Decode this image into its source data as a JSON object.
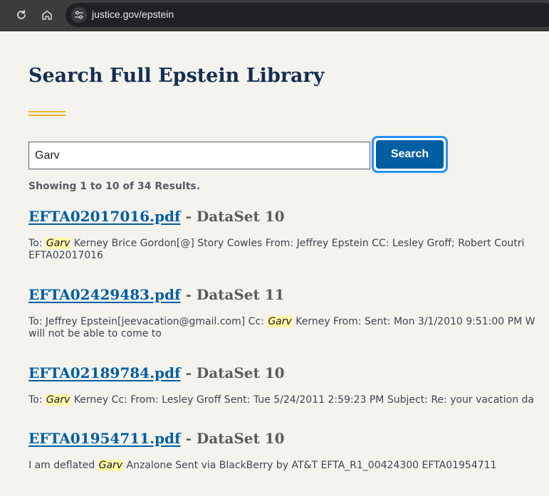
{
  "browser": {
    "url": "justice.gov/epstein"
  },
  "page": {
    "title": "Search Full Epstein Library"
  },
  "search": {
    "value": "Garv",
    "button_label": "Search",
    "results_count": "Showing 1 to 10 of 34 Results."
  },
  "results": [
    {
      "file": "EFTA02017016.pdf",
      "dataset": "- DataSet 10",
      "snippet_lines": [
        {
          "before": "To: ",
          "highlight": "Garv",
          "after": " Kerney Brice Gordon[@] Story Cowles From: Jeffrey Epstein CC: Lesley Groff; Robert Coutri"
        },
        {
          "before": "EFTA02017016",
          "highlight": "",
          "after": ""
        }
      ]
    },
    {
      "file": "EFTA02429483.pdf",
      "dataset": "- DataSet 11",
      "snippet_lines": [
        {
          "before": "To: Jeffrey Epstein[jeevacation@gmail.com] Cc: ",
          "highlight": "Garv",
          "after": " Kerney From: Sent: Mon 3/1/2010 9:51:00 PM W"
        },
        {
          "before": "will not be able to come to",
          "highlight": "",
          "after": ""
        }
      ]
    },
    {
      "file": "EFTA02189784.pdf",
      "dataset": "- DataSet 10",
      "snippet_lines": [
        {
          "before": "To: ",
          "highlight": "Garv",
          "after": " Kerney Cc: From: Lesley Groff Sent: Tue 5/24/2011 2:59:23 PM Subject: Re: your vacation da"
        }
      ]
    },
    {
      "file": "EFTA01954711.pdf",
      "dataset": "- DataSet 10",
      "snippet_lines": [
        {
          "before": "I am deflated ",
          "highlight": "Garv",
          "after": " Anzalone Sent via BlackBerry by AT&T EFTA_R1_00424300 EFTA01954711"
        }
      ]
    }
  ]
}
